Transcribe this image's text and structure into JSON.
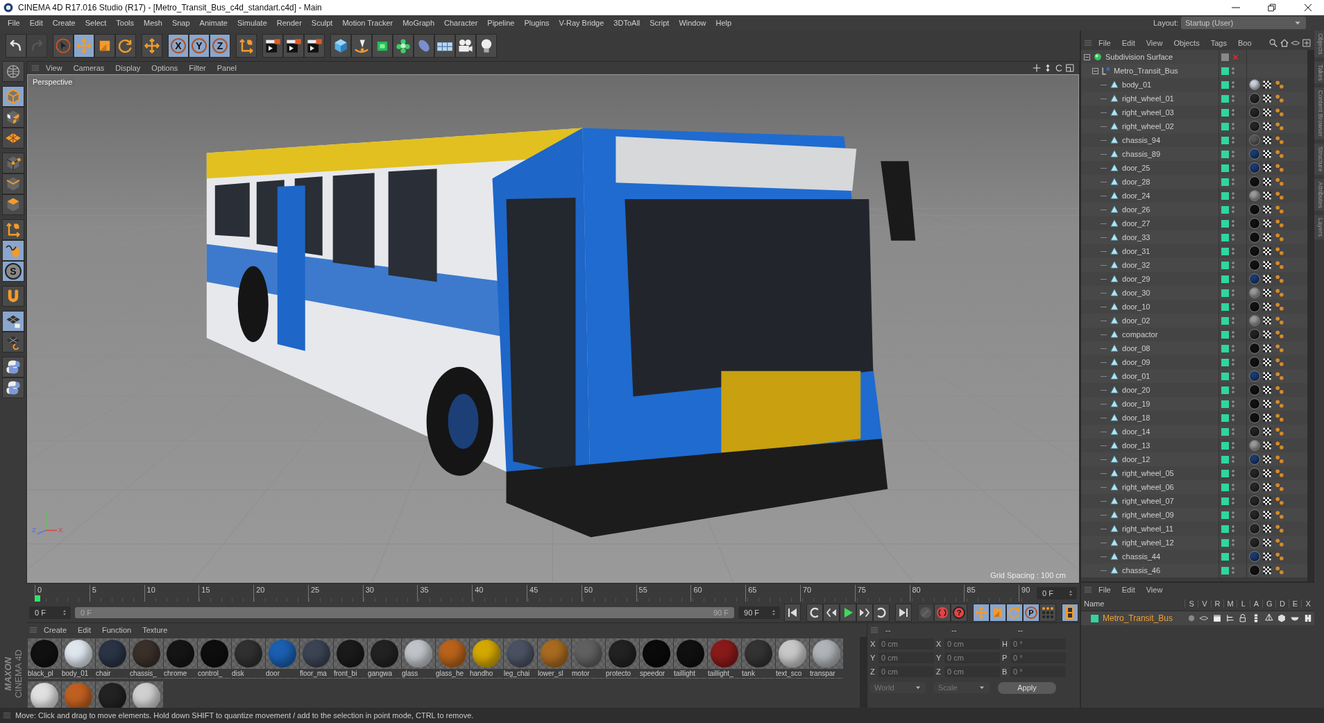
{
  "window": {
    "title": "CINEMA 4D R17.016 Studio (R17) - [Metro_Transit_Bus_c4d_standart.c4d] - Main"
  },
  "menu": [
    "File",
    "Edit",
    "Create",
    "Select",
    "Tools",
    "Mesh",
    "Snap",
    "Animate",
    "Simulate",
    "Render",
    "Sculpt",
    "Motion Tracker",
    "MoGraph",
    "Character",
    "Pipeline",
    "Plugins",
    "V-Ray Bridge",
    "3DToAll",
    "Script",
    "Window",
    "Help"
  ],
  "layout": {
    "label": "Layout:",
    "value": "Startup (User)"
  },
  "toolbar": [
    {
      "active": false,
      "disabled": false
    },
    {
      "active": false,
      "disabled": true
    },
    {
      "active": false,
      "disabled": false
    },
    {
      "active": true,
      "disabled": false
    },
    {
      "active": false,
      "disabled": false
    },
    {
      "active": false,
      "disabled": false
    },
    {
      "active": false,
      "disabled": false
    },
    {
      "active": true,
      "disabled": false,
      "label": "X"
    },
    {
      "active": true,
      "disabled": false,
      "label": "Y"
    },
    {
      "active": true,
      "disabled": false,
      "label": "Z"
    },
    {
      "active": false,
      "disabled": false
    },
    {
      "active": false,
      "disabled": false
    },
    {
      "active": false,
      "disabled": false
    },
    {
      "active": false,
      "disabled": false
    },
    {
      "active": false,
      "disabled": false
    },
    {
      "active": false,
      "disabled": false
    },
    {
      "active": false,
      "disabled": false
    },
    {
      "active": false,
      "disabled": false
    },
    {
      "active": false,
      "disabled": false
    },
    {
      "active": false,
      "disabled": false
    },
    {
      "active": false,
      "disabled": false
    },
    {
      "active": false,
      "disabled": false
    }
  ],
  "left_toolbar": [
    {
      "active": false
    },
    {
      "active": true
    },
    {
      "active": false
    },
    {
      "active": false
    },
    {
      "active": false
    },
    {
      "active": false
    },
    {
      "active": false
    },
    {
      "active": false
    },
    {
      "active": true
    },
    {
      "active": true,
      "label": "S"
    },
    {
      "active": false
    },
    {
      "active": true
    },
    {
      "active": false
    },
    {
      "active": false
    },
    {
      "active": false
    }
  ],
  "brand": [
    "MAXON",
    "CINEMA 4D"
  ],
  "viewport": {
    "menu": [
      "View",
      "Cameras",
      "Display",
      "Options",
      "Filter",
      "Panel"
    ],
    "camera": "Perspective",
    "grid_spacing": "Grid Spacing : 100 cm",
    "axes": [
      "Y",
      "Z",
      "X"
    ]
  },
  "timeline": {
    "ticks": [
      "0",
      "5",
      "10",
      "15",
      "20",
      "25",
      "30",
      "35",
      "40",
      "45",
      "50",
      "55",
      "60",
      "65",
      "70",
      "75",
      "80",
      "85",
      "90"
    ],
    "level": 0,
    "current_frame": "0 F",
    "start": "0 F",
    "range": {
      "start": "0 F",
      "end": "90 F",
      "level": 1
    },
    "end": "90 F"
  },
  "transport": [
    {
      "active": false,
      "disabled": false
    },
    {
      "active": false,
      "disabled": false
    },
    {
      "active": false,
      "disabled": false
    },
    {
      "active": false,
      "disabled": false
    },
    {
      "active": false,
      "disabled": false
    },
    {
      "active": false,
      "disabled": false
    },
    {
      "active": false,
      "disabled": false
    },
    {
      "active": false,
      "disabled": true
    },
    {
      "active": false,
      "disabled": false
    },
    {
      "active": false,
      "disabled": false,
      "label": "?"
    },
    {
      "active": true,
      "disabled": false
    },
    {
      "active": true,
      "disabled": false
    },
    {
      "active": true,
      "disabled": false
    },
    {
      "active": true,
      "disabled": false,
      "label": "P"
    },
    {
      "active": false,
      "disabled": false
    },
    {
      "active": true,
      "disabled": false
    }
  ],
  "materials": {
    "menu": [
      "Create",
      "Edit",
      "Function",
      "Texture"
    ],
    "items": [
      {
        "name": "black_pl",
        "color": "#111111"
      },
      {
        "name": "body_01",
        "color": "#dfe6ee"
      },
      {
        "name": "chair",
        "color": "#2a3445"
      },
      {
        "name": "chassis_",
        "color": "#3a302a"
      },
      {
        "name": "chrome",
        "color": "#151515"
      },
      {
        "name": "control_",
        "color": "#0e0e0e"
      },
      {
        "name": "disk",
        "color": "#303030"
      },
      {
        "name": "door",
        "color": "#1a5fb0"
      },
      {
        "name": "floor_ma",
        "color": "#3c4454"
      },
      {
        "name": "front_bi",
        "color": "#1a1a1a"
      },
      {
        "name": "gangwa",
        "color": "#222222"
      },
      {
        "name": "glass",
        "color": "#c0c4c8"
      },
      {
        "name": "glass_he",
        "color": "#b8621a"
      },
      {
        "name": "handho",
        "color": "#d4a800"
      },
      {
        "name": "leg_chai",
        "color": "#4a5262"
      },
      {
        "name": "lower_sl",
        "color": "#a86a20"
      },
      {
        "name": "motor",
        "color": "#606060"
      },
      {
        "name": "protecto",
        "color": "#222222"
      },
      {
        "name": "speedor",
        "color": "#0a0a0a"
      },
      {
        "name": "taillight",
        "color": "#101010"
      },
      {
        "name": "taillight_",
        "color": "#8a1a1a"
      },
      {
        "name": "tank",
        "color": "#333333"
      },
      {
        "name": "text_sco",
        "color": "#c8c8c8"
      },
      {
        "name": "transpar",
        "color": "#b0b4b8"
      },
      {
        "color": "#e0e0e0"
      },
      {
        "color": "#c06020"
      },
      {
        "color": "#222222"
      },
      {
        "color": "#d0d0d0"
      }
    ]
  },
  "coordinates": {
    "headers": [
      "--",
      "--",
      "--"
    ],
    "rows": [
      {
        "axis": "X",
        "value": "0 cm",
        "axis2": "X",
        "value2": "0 cm",
        "axis3": "H",
        "value3": "0 °"
      },
      {
        "axis": "Y",
        "value": "0 cm",
        "axis2": "Y",
        "value2": "0 cm",
        "axis3": "P",
        "value3": "0 °"
      },
      {
        "axis": "Z",
        "value": "0 cm",
        "axis2": "Z",
        "value2": "0 cm",
        "axis3": "B",
        "value3": "0 °"
      }
    ],
    "dropdowns": [
      "World",
      "Scale"
    ],
    "apply": "Apply"
  },
  "objects": {
    "menu": [
      "File",
      "Edit",
      "View",
      "Objects",
      "Tags",
      "Boo"
    ],
    "tree": [
      {
        "name": "Subdivision Surface",
        "kind": "subdivision",
        "expanded": true,
        "enabled": false,
        "children": [
          {
            "name": "Metro_Transit_Bus",
            "kind": "null",
            "expanded": true,
            "children": [
              {
                "name": "body_01",
                "kind": "polygon",
                "color": "#c8d0dc"
              },
              {
                "name": "right_wheel_01",
                "kind": "polygon",
                "color": "#252525"
              },
              {
                "name": "right_wheel_03",
                "kind": "polygon",
                "color": "#252525"
              },
              {
                "name": "right_wheel_02",
                "kind": "polygon",
                "color": "#252525"
              },
              {
                "name": "chassis_94",
                "kind": "polygon",
                "color": "#555555"
              },
              {
                "name": "chassis_89",
                "kind": "polygon",
                "color": "#1a3a70"
              },
              {
                "name": "door_25",
                "kind": "polygon",
                "color": "#1a3a70"
              },
              {
                "name": "door_28",
                "kind": "polygon",
                "color": "#111111"
              },
              {
                "name": "door_24",
                "kind": "polygon",
                "color": "#999999"
              },
              {
                "name": "door_26",
                "kind": "polygon",
                "color": "#111111"
              },
              {
                "name": "door_27",
                "kind": "polygon",
                "color": "#111111"
              },
              {
                "name": "door_33",
                "kind": "polygon",
                "color": "#111111"
              },
              {
                "name": "door_31",
                "kind": "polygon",
                "color": "#111111"
              },
              {
                "name": "door_32",
                "kind": "polygon",
                "color": "#111111"
              },
              {
                "name": "door_29",
                "kind": "polygon",
                "color": "#1a3a70"
              },
              {
                "name": "door_30",
                "kind": "polygon",
                "color": "#999999"
              },
              {
                "name": "door_10",
                "kind": "polygon",
                "color": "#111111"
              },
              {
                "name": "door_02",
                "kind": "polygon",
                "color": "#999999"
              },
              {
                "name": "compactor",
                "kind": "polygon",
                "color": "#222222"
              },
              {
                "name": "door_08",
                "kind": "polygon",
                "color": "#111111"
              },
              {
                "name": "door_09",
                "kind": "polygon",
                "color": "#111111"
              },
              {
                "name": "door_01",
                "kind": "polygon",
                "color": "#1a3a70"
              },
              {
                "name": "door_20",
                "kind": "polygon",
                "color": "#111111"
              },
              {
                "name": "door_19",
                "kind": "polygon",
                "color": "#111111"
              },
              {
                "name": "door_18",
                "kind": "polygon",
                "color": "#111111"
              },
              {
                "name": "door_14",
                "kind": "polygon",
                "color": "#222222"
              },
              {
                "name": "door_13",
                "kind": "polygon",
                "color": "#999999"
              },
              {
                "name": "door_12",
                "kind": "polygon",
                "color": "#1a3a70"
              },
              {
                "name": "right_wheel_05",
                "kind": "polygon",
                "color": "#252525"
              },
              {
                "name": "right_wheel_06",
                "kind": "polygon",
                "color": "#252525"
              },
              {
                "name": "right_wheel_07",
                "kind": "polygon",
                "color": "#252525"
              },
              {
                "name": "right_wheel_09",
                "kind": "polygon",
                "color": "#252525"
              },
              {
                "name": "right_wheel_11",
                "kind": "polygon",
                "color": "#252525"
              },
              {
                "name": "right_wheel_12",
                "kind": "polygon",
                "color": "#252525"
              },
              {
                "name": "chassis_44",
                "kind": "polygon",
                "color": "#1a3a70"
              },
              {
                "name": "chassis_46",
                "kind": "polygon",
                "color": "#111111"
              }
            ]
          }
        ]
      }
    ]
  },
  "layers": {
    "menu": [
      "File",
      "Edit",
      "View"
    ],
    "columns": [
      "Name",
      "S",
      "V",
      "R",
      "M",
      "L",
      "A",
      "G",
      "D",
      "E",
      "X"
    ],
    "rows": [
      {
        "name": "Metro_Transit_Bus",
        "color": "#2fd6a0"
      }
    ]
  },
  "side_tabs": [
    "Objects",
    "Takes",
    "Content Browser",
    "Structure",
    "Attributes",
    "Layers"
  ],
  "status": "Move: Click and drag to move elements. Hold down SHIFT to quantize movement / add to the selection in point mode, CTRL to remove."
}
